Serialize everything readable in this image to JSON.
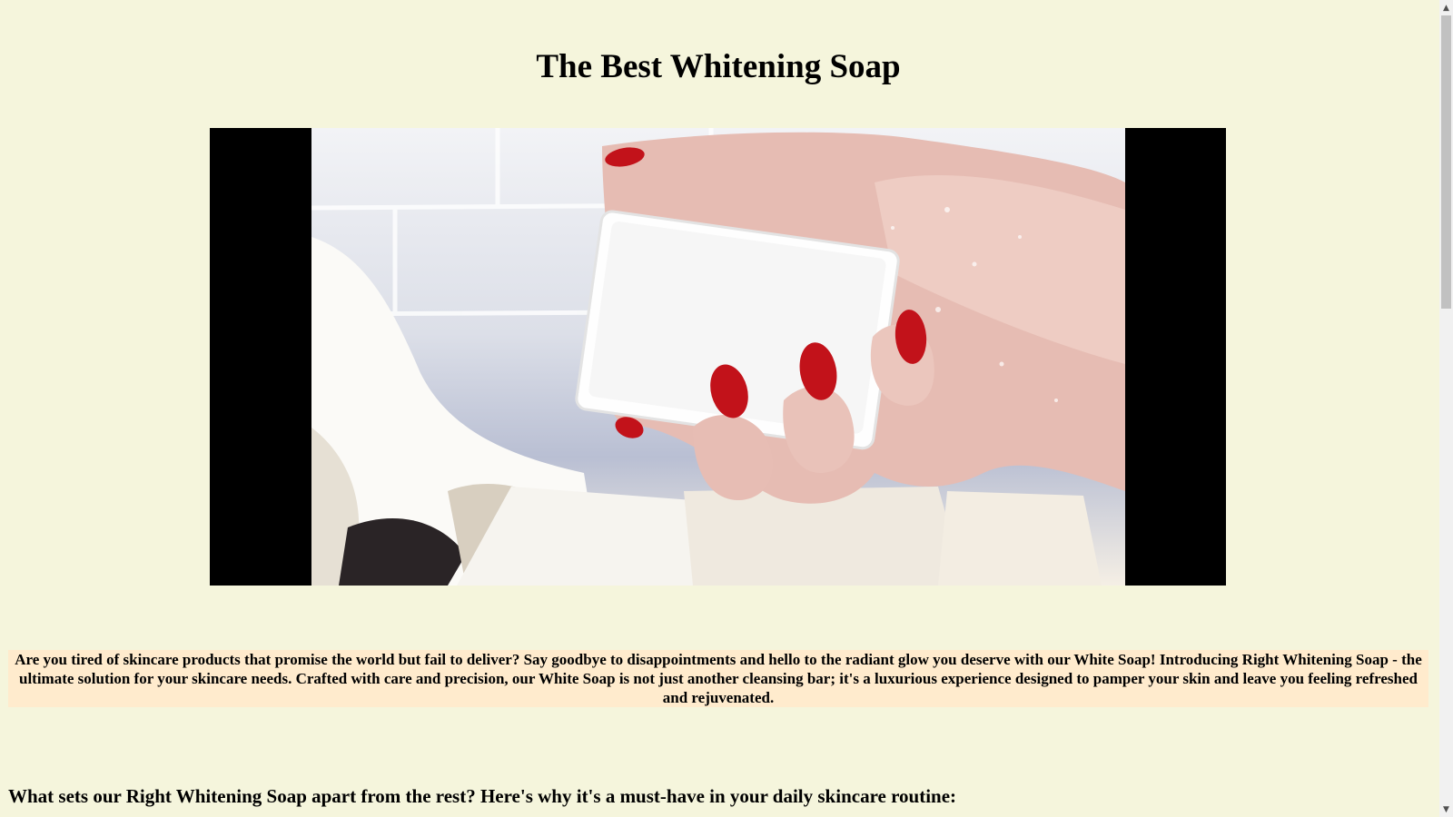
{
  "page": {
    "title": "The Best Whitening Soap",
    "video": {
      "description": "hand-holding-white-soap-bar"
    },
    "intro": "Are you tired of skincare products that promise the world but fail to deliver? Say goodbye to disappointments and hello to the radiant glow you deserve with our White Soap! Introducing Right Whitening Soap - the ultimate solution for your skincare needs. Crafted with care and precision, our White Soap is not just another cleansing bar; it's a luxurious experience designed to pamper your skin and leave you feeling refreshed and rejuvenated.",
    "section_heading": "What sets our Right Whitening Soap apart from the rest? Here's why it's a must-have in your daily skincare routine:"
  },
  "scrollbar": {
    "up_icon": "triangle-up-icon",
    "down_icon": "triangle-down-icon",
    "position": 0.0
  },
  "colors": {
    "page_background": "#f5f5dc",
    "intro_background": "#ffebcd",
    "video_letterbox": "#000000",
    "nail_polish": "#c2121a"
  }
}
